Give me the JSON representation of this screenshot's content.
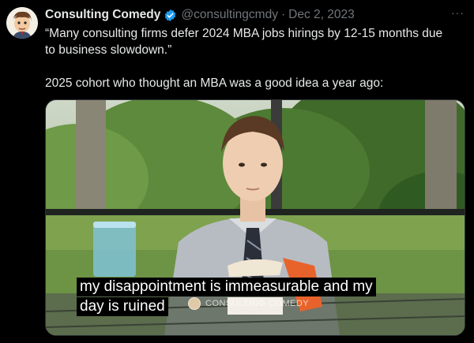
{
  "tweet": {
    "display_name": "Consulting Comedy",
    "handle": "@consultingcmdy",
    "separator": "·",
    "date": "Dec 2, 2023",
    "more": "···",
    "paragraphs": [
      "“Many consulting firms defer 2024 MBA jobs hirings by 12-15 months due to business slowdown.”",
      "2025 cohort who thought an MBA was a good idea a year ago:"
    ]
  },
  "media": {
    "caption_lines": [
      "my disappointment is immeasurable and my",
      "day is ruined"
    ],
    "watermark": "CONSULTING COMEDY"
  },
  "colors": {
    "background": "#000000",
    "text": "#e7e9ea",
    "secondary_text": "#71767b",
    "verified_blue": "#1d9bf0"
  },
  "icons": [
    "avatar-cartoon",
    "verified-badge-icon",
    "more-options-icon"
  ]
}
